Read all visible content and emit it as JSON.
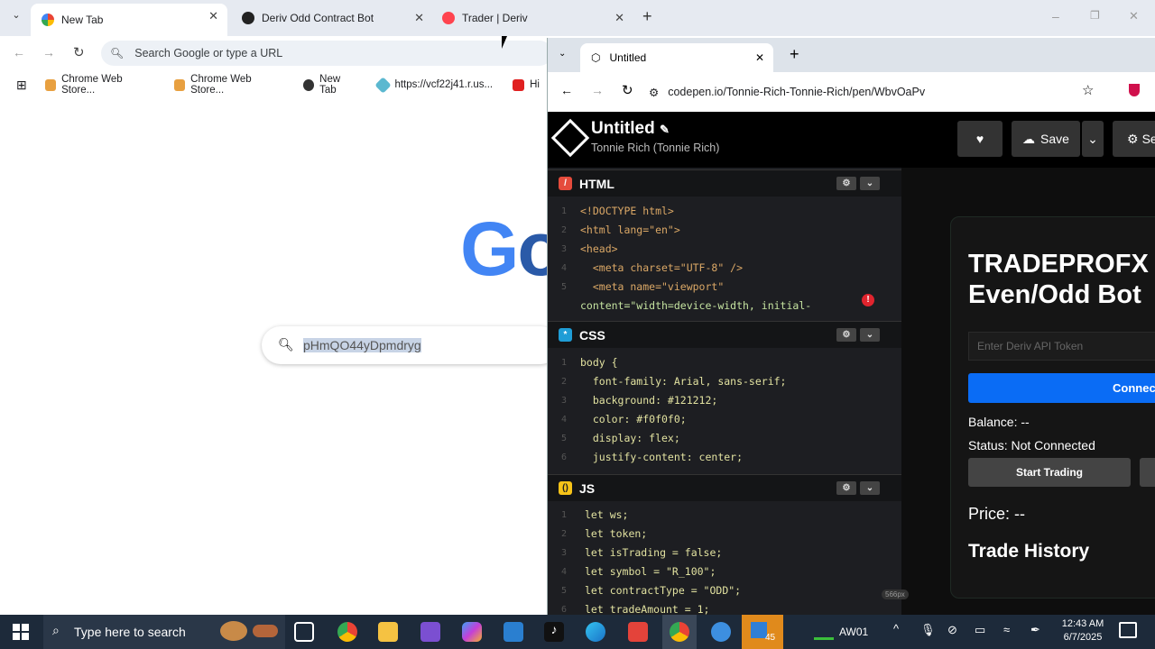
{
  "browser": {
    "tabs": [
      {
        "title": "New Tab"
      },
      {
        "title": "Deriv Odd Contract Bot"
      },
      {
        "title": "Trader | Deriv"
      }
    ],
    "omnibox_placeholder": "Search Google or type a URL",
    "bookmarks": [
      "Chrome Web Store...",
      "Chrome Web Store...",
      "New Tab",
      "https://vcf22j41.r.us...",
      "Hi"
    ],
    "google_logo": "Go",
    "search_value": "pHmQO44yDpmdryg"
  },
  "codepen_window": {
    "tab_title": "Untitled",
    "url": "codepen.io/Tonnie-Rich-Tonnie-Rich/pen/WbvOaPv",
    "pen_title": "Untitled",
    "pen_author": "Tonnie Rich (Tonnie Rich)",
    "save_label": "Save",
    "settings_label": "Se",
    "editors": {
      "html": {
        "label": "HTML",
        "lines": [
          "<!DOCTYPE html>",
          "<html lang=\"en\">",
          "<head>",
          "  <meta charset=\"UTF-8\" />",
          "  <meta name=\"viewport\"",
          "content=\"width=device-width, initial-"
        ]
      },
      "css": {
        "label": "CSS",
        "lines": [
          "body {",
          "  font-family: Arial, sans-serif;",
          "  background: #121212;",
          "  color: #f0f0f0;",
          "  display: flex;",
          "  justify-content: center;"
        ]
      },
      "js": {
        "label": "JS",
        "lines": [
          "let ws;",
          "let token;",
          "let isTrading = false;",
          "let symbol = \"R_100\";",
          "let contractType = \"ODD\";",
          "let tradeAmount = 1;"
        ]
      }
    },
    "preview": {
      "title_line1": "TRADEPROFX",
      "title_line2": "Even/Odd Bot",
      "token_placeholder": "Enter Deriv API Token",
      "connect_label": "Connect",
      "balance": "Balance: --",
      "status": "Status: Not Connected",
      "start_label": "Start Trading",
      "price": "Price: --",
      "history_heading": "Trade History",
      "size_badge": "566px"
    }
  },
  "taskbar": {
    "search_placeholder": "Type here to search",
    "badge_count": "45",
    "tray_label": "AW01",
    "time": "12:43 AM",
    "date": "6/7/2025"
  }
}
